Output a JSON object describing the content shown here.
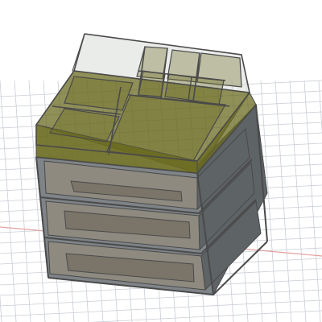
{
  "viewport": {
    "background_color": "#ffffff",
    "grid_line_color": "#c9ced6",
    "axis_line_color": "#e3a0a0"
  },
  "model": {
    "frame_color": "#4a4a4a",
    "frame_face_color": "#7f8488",
    "frame_side_color": "#5e6366",
    "drawer_face_color": "#8e8a80",
    "drawer_panel_color": "#7a7568",
    "organizer_tint_color": "#6a6a20",
    "organizer_glass_color": "#d8dcd8",
    "drawer_count": 3
  }
}
